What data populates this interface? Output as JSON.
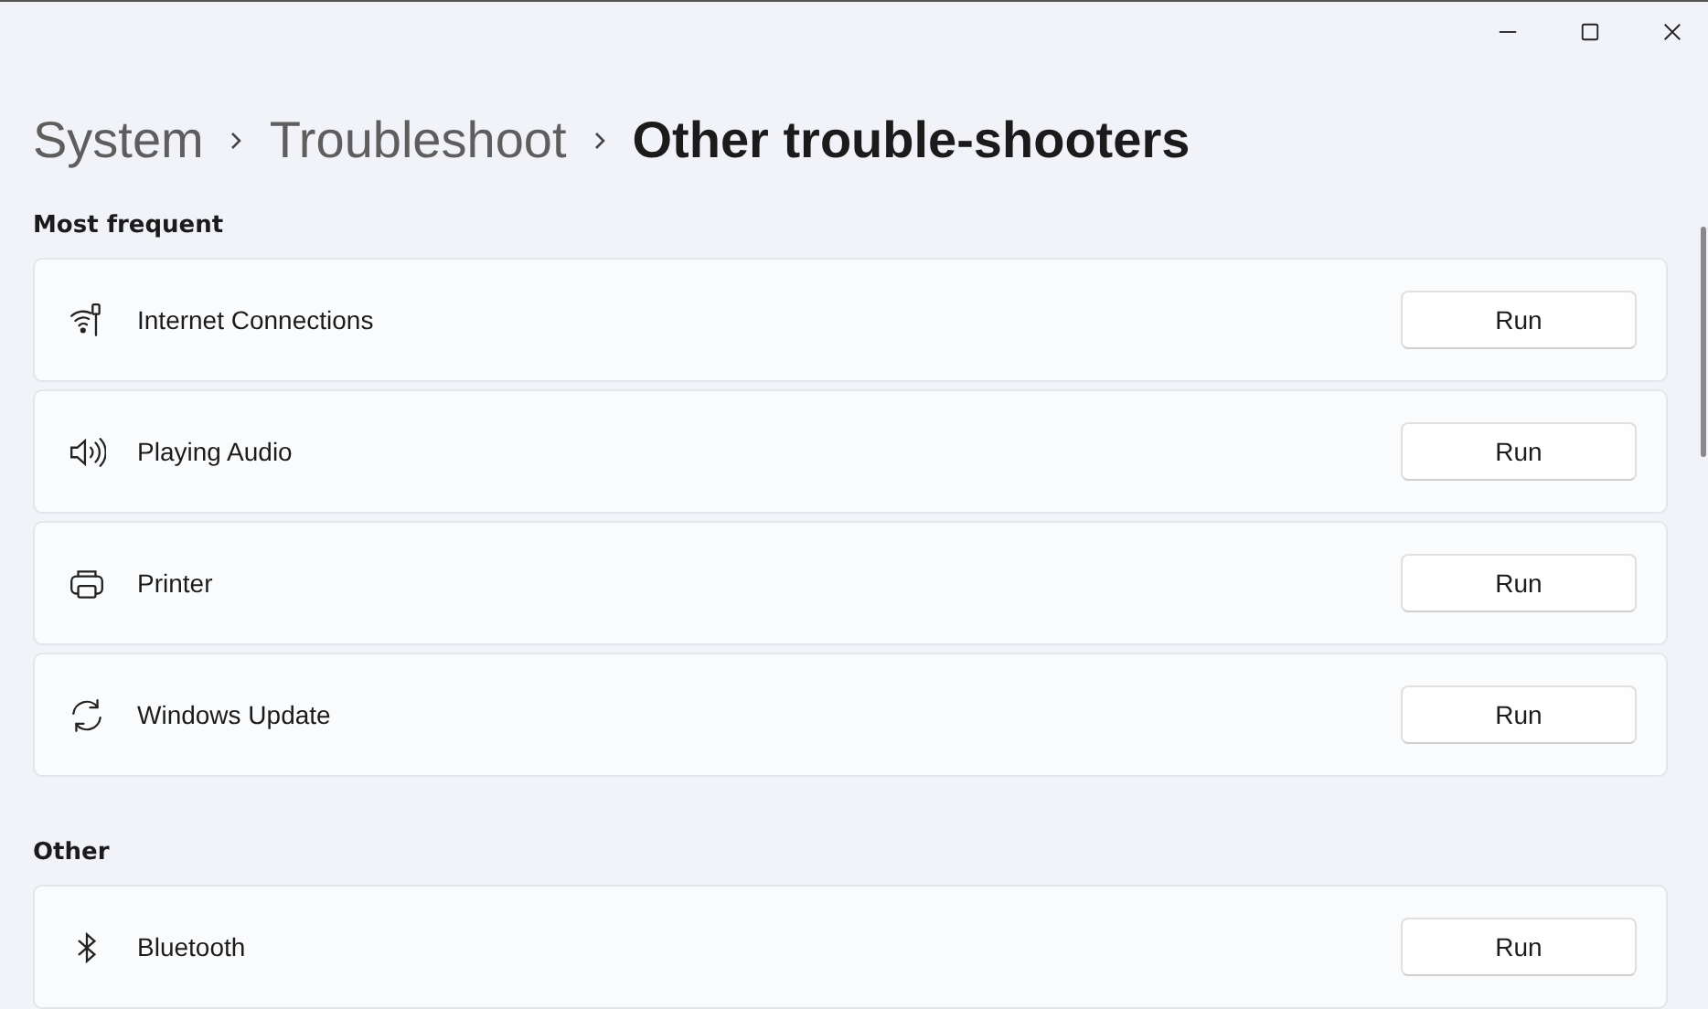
{
  "breadcrumb": [
    {
      "label": "System",
      "current": false
    },
    {
      "label": "Troubleshoot",
      "current": false
    },
    {
      "label": "Other trouble-shooters",
      "current": true
    }
  ],
  "sections": [
    {
      "title": "Most frequent",
      "items": [
        {
          "kind": "wifi",
          "label": "Internet Connections",
          "button": "Run"
        },
        {
          "kind": "speaker",
          "label": "Playing Audio",
          "button": "Run"
        },
        {
          "kind": "printer",
          "label": "Printer",
          "button": "Run"
        },
        {
          "kind": "refresh",
          "label": "Windows Update",
          "button": "Run"
        }
      ]
    },
    {
      "title": "Other",
      "items": [
        {
          "kind": "bluetooth",
          "label": "Bluetooth",
          "button": "Run"
        }
      ]
    }
  ]
}
